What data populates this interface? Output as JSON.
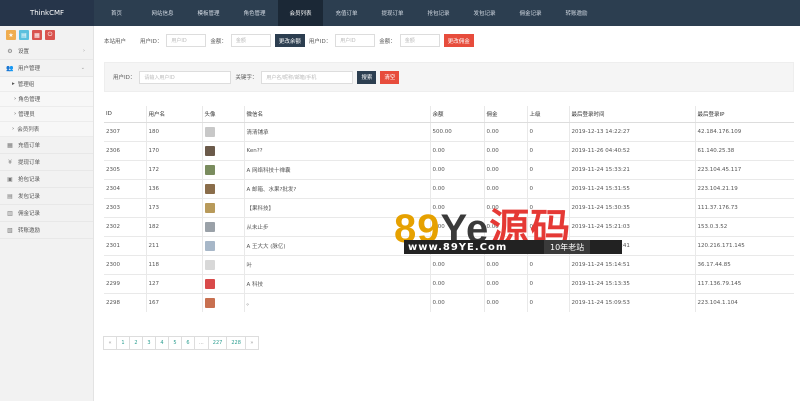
{
  "brand": "ThinkCMF",
  "nav": [
    "首页",
    "网站信息",
    "模板管理",
    "角色管理",
    "会员列表",
    "充值订单",
    "提现订单",
    "抢包记录",
    "发包记录",
    "佣金记录",
    "转账邀励"
  ],
  "sidebar": {
    "items": [
      {
        "label": "设置",
        "icon": "gear-icon"
      },
      {
        "label": "用户管理",
        "icon": "users-icon"
      }
    ],
    "sub_group": "管理组",
    "sub_items": [
      "角色管理",
      "管理员"
    ],
    "member_list": "会员列表",
    "rest": [
      {
        "label": "充值订单",
        "icon": "recharge-icon"
      },
      {
        "label": "提现订单",
        "icon": "withdraw-icon"
      },
      {
        "label": "抢包记录",
        "icon": "grab-icon"
      },
      {
        "label": "发包记录",
        "icon": "send-icon"
      },
      {
        "label": "佣金记录",
        "icon": "commission-icon"
      },
      {
        "label": "转账邀励",
        "icon": "transfer-icon"
      }
    ]
  },
  "form1": {
    "label": "本站用户",
    "uid_label": "用户ID：",
    "uid_placeholder": "用户ID",
    "amount_label": "金额：",
    "amount_placeholder": "金额",
    "btn_balance": "更改余额",
    "uid2_label": "用户ID：",
    "uid2_placeholder": "用户ID",
    "amount2_label": "金额：",
    "amount2_placeholder": "金额",
    "btn_commission": "更改佣金"
  },
  "filter": {
    "uid_label": "用户ID：",
    "uid_placeholder": "请输入用户ID",
    "kw_label": "关键字：",
    "kw_placeholder": "用户名/昵称/邮箱/手机",
    "search_btn": "搜索",
    "clear_btn": "清空"
  },
  "table": {
    "headers": [
      "ID",
      "用户名",
      "头像",
      "微信名",
      "余额",
      "佣金",
      "上级",
      "最后登录时间",
      "最后登录IP"
    ],
    "rows": [
      {
        "id": "2307",
        "user": "180",
        "wx": "清清铺承",
        "bal": "500.00",
        "com": "0.00",
        "up": "0",
        "time": "2019-12-13 14:22:27",
        "ip": "42.184.176.109",
        "av": "#c8c8c8"
      },
      {
        "id": "2306",
        "user": "170",
        "wx": "Ken??",
        "bal": "0.00",
        "com": "0.00",
        "up": "0",
        "time": "2019-11-26 04:40:52",
        "ip": "61.140.25.38",
        "av": "#6b5a4a"
      },
      {
        "id": "2305",
        "user": "172",
        "wx": "A 网络科技十禅囊",
        "bal": "0.00",
        "com": "0.00",
        "up": "0",
        "time": "2019-11-24 15:33:21",
        "ip": "223.104.45.117",
        "av": "#7a8c5e"
      },
      {
        "id": "2304",
        "user": "136",
        "wx": "A 邮箱、水果?批发?",
        "bal": "0.00",
        "com": "0.00",
        "up": "0",
        "time": "2019-11-24 15:31:55",
        "ip": "223.104.21.19",
        "av": "#8a6d4a"
      },
      {
        "id": "2303",
        "user": "173",
        "wx": "【果科技】",
        "bal": "0.00",
        "com": "0.00",
        "up": "0",
        "time": "2019-11-24 15:30:35",
        "ip": "111.37.176.73",
        "av": "#b89a5a"
      },
      {
        "id": "2302",
        "user": "182",
        "wx": "从未止步",
        "bal": "0.00",
        "com": "0.00",
        "up": "0",
        "time": "2019-11-24 15:21:03",
        "ip": "153.0.3.52",
        "av": "#9aa1a8"
      },
      {
        "id": "2301",
        "user": "211",
        "wx": "A 王大大 (脉亿)",
        "bal": "0.00",
        "com": "0.00",
        "up": "0",
        "time": "2019-11-24 15:15:41",
        "ip": "120.216.171.145",
        "av": "#a7b7c8"
      },
      {
        "id": "2300",
        "user": "118",
        "wx": "叶",
        "bal": "0.00",
        "com": "0.00",
        "up": "0",
        "time": "2019-11-24 15:14:51",
        "ip": "36.17.44.85",
        "av": "#d8d8d8"
      },
      {
        "id": "2299",
        "user": "127",
        "wx": "A 科技",
        "bal": "0.00",
        "com": "0.00",
        "up": "0",
        "time": "2019-11-24 15:13:35",
        "ip": "117.136.79.145",
        "av": "#d94a4a"
      },
      {
        "id": "2298",
        "user": "167",
        "wx": "。",
        "bal": "0.00",
        "com": "0.00",
        "up": "0",
        "time": "2019-11-24 15:09:53",
        "ip": "223.104.1.104",
        "av": "#c87050"
      }
    ]
  },
  "pager": [
    "«",
    "1",
    "2",
    "3",
    "4",
    "5",
    "6",
    "...",
    "227",
    "228",
    "»"
  ],
  "watermark": {
    "big_8": "89",
    "big_ye": "Ye",
    "big_cn": "源码",
    "url": "www.89YE.Com",
    "slogan": "10年老站"
  }
}
